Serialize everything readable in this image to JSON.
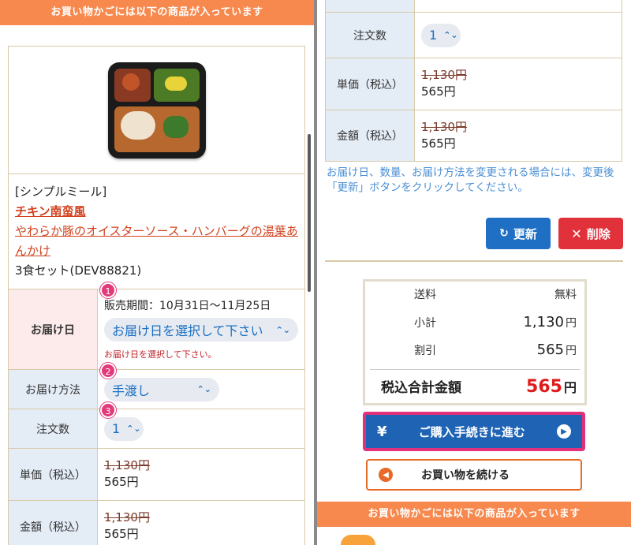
{
  "banner": "お買い物かごには以下の商品が入っています",
  "product": {
    "brand": "[シンプルミール]",
    "name1": "チキン南蛮風",
    "name2": "やわらか豚のオイスターソース・ハンバーグの湯葉あんかけ",
    "set": "3食セット(DEV88821)"
  },
  "delivery_date": {
    "label": "お届け日",
    "badge": "1",
    "period": "販売期間：10月31日〜11月25日",
    "select_value": "お届け日を選択して下さい",
    "error": "お届け日を選択して下さい。"
  },
  "delivery_method": {
    "label": "お届け方法",
    "badge": "2",
    "value": "手渡し"
  },
  "quantity": {
    "label": "注文数",
    "badge": "3",
    "value": "1"
  },
  "unit_price": {
    "label": "単価（税込）",
    "original": "1,130円",
    "price": "565円"
  },
  "amount": {
    "label": "金額（税込）",
    "original": "1,130円",
    "price": "565円"
  },
  "note": "お届け日、数量、お届け方法を変更される場合には、変更後「更新」ボタンをクリックしてください。",
  "buttons": {
    "update": "更新",
    "delete": "削除",
    "checkout": "ご購入手続きに進む",
    "continue": "お買い物を続ける",
    "checkout_symbol": "¥"
  },
  "summary": {
    "shipping_label": "送料",
    "shipping_value": "無料",
    "subtotal_label": "小計",
    "subtotal_value": "1,130",
    "discount_label": "割引",
    "discount_value": "565",
    "total_label": "税込合計金額",
    "total_value": "565",
    "unit": "円"
  },
  "colors": {
    "banner": "#f7894e",
    "update": "#1f6fc5",
    "delete": "#e1323c",
    "checkout": "#1e63b4",
    "checkout_border": "#e0317a",
    "total": "#e01b1b"
  },
  "icons": [
    "chevron-updown-icon",
    "refresh-icon",
    "close-icon",
    "yen-icon",
    "arrow-right-circle-icon",
    "arrow-left-circle-icon"
  ]
}
